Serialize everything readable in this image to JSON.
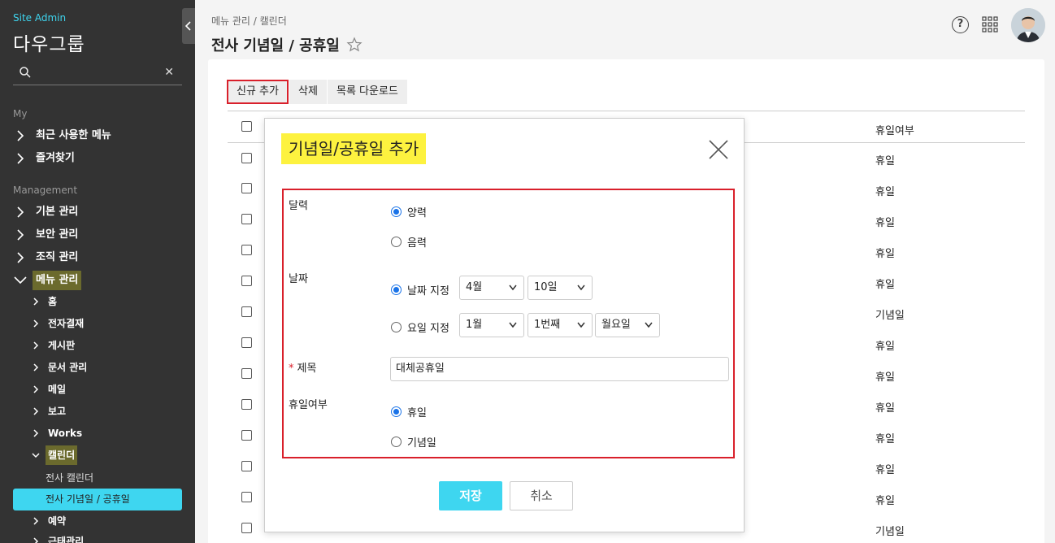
{
  "sidebar": {
    "site_label": "Site Admin",
    "company": "다우그룹",
    "section_my": "My",
    "my_items": [
      {
        "label": "최근 사용한 메뉴"
      },
      {
        "label": "즐겨찾기"
      }
    ],
    "section_management": "Management",
    "mgmt_items": [
      {
        "label": "기본 관리"
      },
      {
        "label": "보안 관리"
      },
      {
        "label": "조직 관리"
      },
      {
        "label": "메뉴 관리"
      }
    ],
    "sub_items": [
      {
        "label": "홈"
      },
      {
        "label": "전자결재"
      },
      {
        "label": "게시판"
      },
      {
        "label": "문서 관리"
      },
      {
        "label": "메일"
      },
      {
        "label": "보고"
      },
      {
        "label": "Works"
      },
      {
        "label": "캘린더"
      }
    ],
    "calendar_items": [
      {
        "label": "전사 캘린더"
      },
      {
        "label": "전사 기념일 / 공휴일"
      }
    ],
    "more_items": [
      {
        "label": "예약"
      },
      {
        "label": "근태관리"
      }
    ]
  },
  "header": {
    "breadcrumb": "메뉴 관리 / 캘린더",
    "title": "전사 기념일 / 공휴일",
    "help_glyph": "?"
  },
  "toolbar": {
    "add_label": "신규 추가",
    "delete_label": "삭제",
    "download_label": "목록 다운로드"
  },
  "table": {
    "col_holiday_header": "휴일여부",
    "rows": [
      "휴일",
      "휴일",
      "휴일",
      "휴일",
      "휴일",
      "기념일",
      "휴일",
      "휴일",
      "휴일",
      "휴일",
      "휴일",
      "휴일",
      "기념일"
    ]
  },
  "dialog": {
    "title": "기념일/공휴일 추가",
    "calendar_label": "달력",
    "calendar_options": [
      "양력",
      "음력"
    ],
    "date_label": "날짜",
    "date_fixed_label": "날짜 지정",
    "date_fixed_month": "4월",
    "date_fixed_day": "10일",
    "date_weekday_label": "요일 지정",
    "date_weekday_month": "1월",
    "date_weekday_week": "1번째",
    "date_weekday_day": "월요일",
    "required_mark": "*",
    "subject_label": "제목",
    "subject_value": "대체공휴일",
    "holiday_label": "휴일여부",
    "holiday_options": [
      "휴일",
      "기념일"
    ],
    "save_label": "저장",
    "cancel_label": "취소"
  },
  "colors": {
    "accent": "#3ed6f0",
    "highlight_red": "#d9202b",
    "title_highlight": "#fdf23f",
    "sidebar_bg": "#333333"
  }
}
